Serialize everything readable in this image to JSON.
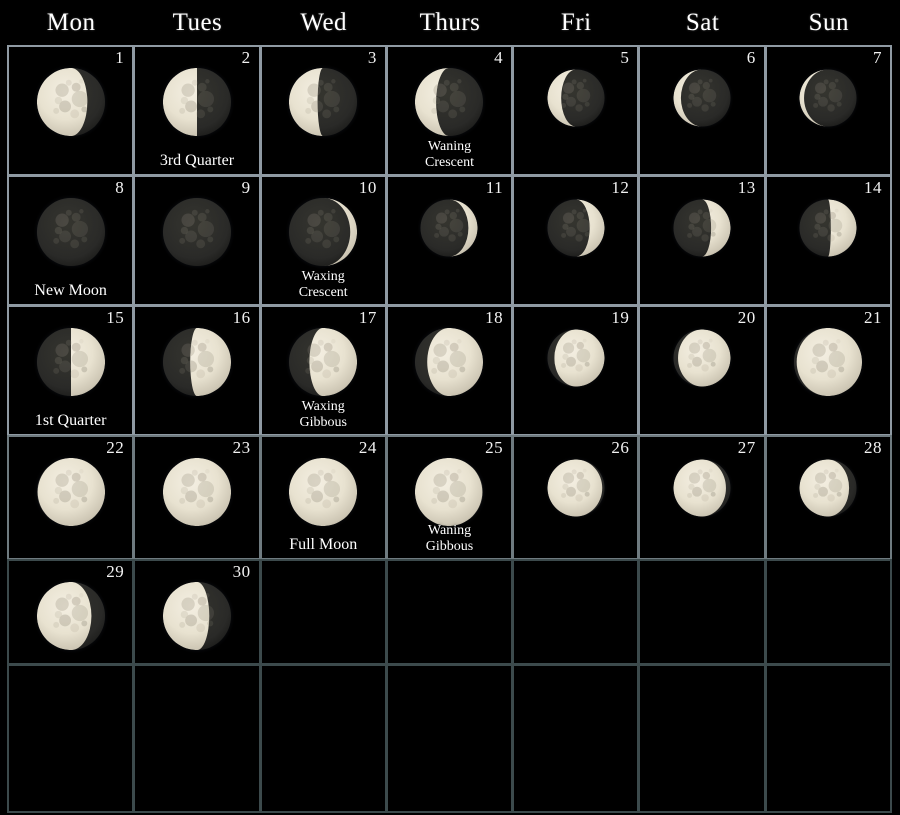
{
  "header": {
    "weekdays": [
      "Mon",
      "Tues",
      "Wed",
      "Thurs",
      "Fri",
      "Sat",
      "Sun"
    ]
  },
  "colors": {
    "background": "#000000",
    "grid_border_bright": "#8f9aa3",
    "grid_border_dim": "#3c4a4c",
    "moon_lit": "#e8e2d0",
    "moon_dark": "#2a2a28",
    "text": "#ffffff"
  },
  "calendar": {
    "rows": [
      {
        "border": "bright",
        "cells": [
          {
            "day": "1",
            "label": "",
            "phase": "waning-gibbous",
            "illum": 0.74,
            "lit_side": "left",
            "size": "normal"
          },
          {
            "day": "2",
            "label": "3rd Quarter",
            "phase": "third-quarter",
            "illum": 0.5,
            "lit_side": "left",
            "size": "normal"
          },
          {
            "day": "3",
            "label": "",
            "phase": "waning-crescent",
            "illum": 0.42,
            "lit_side": "left",
            "size": "normal"
          },
          {
            "day": "4",
            "label": "Waning\nCrescent",
            "phase": "waning-crescent",
            "illum": 0.31,
            "lit_side": "left",
            "size": "normal"
          },
          {
            "day": "5",
            "label": "",
            "phase": "waning-crescent",
            "illum": 0.24,
            "lit_side": "left",
            "size": "small"
          },
          {
            "day": "6",
            "label": "",
            "phase": "waning-crescent",
            "illum": 0.13,
            "lit_side": "left",
            "size": "small"
          },
          {
            "day": "7",
            "label": "",
            "phase": "waning-crescent",
            "illum": 0.08,
            "lit_side": "left",
            "size": "small"
          }
        ]
      },
      {
        "border": "bright",
        "cells": [
          {
            "day": "8",
            "label": "New Moon",
            "phase": "new-moon",
            "illum": 0.0,
            "lit_side": "right",
            "size": "normal"
          },
          {
            "day": "9",
            "label": "",
            "phase": "new-moon",
            "illum": 0.0,
            "lit_side": "right",
            "size": "normal"
          },
          {
            "day": "10",
            "label": "Waxing\nCrescent",
            "phase": "waxing-crescent",
            "illum": 0.1,
            "lit_side": "right",
            "size": "normal"
          },
          {
            "day": "11",
            "label": "",
            "phase": "waxing-crescent",
            "illum": 0.16,
            "lit_side": "right",
            "size": "small"
          },
          {
            "day": "12",
            "label": "",
            "phase": "waxing-crescent",
            "illum": 0.26,
            "lit_side": "right",
            "size": "small"
          },
          {
            "day": "13",
            "label": "",
            "phase": "waxing-crescent",
            "illum": 0.34,
            "lit_side": "right",
            "size": "small"
          },
          {
            "day": "14",
            "label": "",
            "phase": "waxing-crescent",
            "illum": 0.45,
            "lit_side": "right",
            "size": "small"
          }
        ]
      },
      {
        "border": "bright",
        "cells": [
          {
            "day": "15",
            "label": "1st Quarter",
            "phase": "first-quarter",
            "illum": 0.5,
            "lit_side": "right",
            "size": "normal"
          },
          {
            "day": "16",
            "label": "",
            "phase": "waxing-gibbous",
            "illum": 0.6,
            "lit_side": "right",
            "size": "normal"
          },
          {
            "day": "17",
            "label": "Waxing\nGibbous",
            "phase": "waxing-gibbous",
            "illum": 0.7,
            "lit_side": "right",
            "size": "normal"
          },
          {
            "day": "18",
            "label": "",
            "phase": "waxing-gibbous",
            "illum": 0.82,
            "lit_side": "right",
            "size": "normal"
          },
          {
            "day": "19",
            "label": "",
            "phase": "waxing-gibbous",
            "illum": 0.88,
            "lit_side": "right",
            "size": "small"
          },
          {
            "day": "20",
            "label": "",
            "phase": "waxing-gibbous",
            "illum": 0.92,
            "lit_side": "right",
            "size": "small"
          },
          {
            "day": "21",
            "label": "",
            "phase": "waxing-gibbous",
            "illum": 0.96,
            "lit_side": "right",
            "size": "normal"
          }
        ]
      },
      {
        "border": "mid",
        "cells": [
          {
            "day": "22",
            "label": "",
            "phase": "full-moon",
            "illum": 0.99,
            "lit_side": "right",
            "size": "normal"
          },
          {
            "day": "23",
            "label": "",
            "phase": "full-moon",
            "illum": 1.0,
            "lit_side": "right",
            "size": "normal"
          },
          {
            "day": "24",
            "label": "Full Moon",
            "phase": "full-moon",
            "illum": 1.0,
            "lit_side": "right",
            "size": "normal"
          },
          {
            "day": "25",
            "label": "Waning\nGibbous",
            "phase": "waning-gibbous",
            "illum": 0.99,
            "lit_side": "left",
            "size": "normal"
          },
          {
            "day": "26",
            "label": "",
            "phase": "waning-gibbous",
            "illum": 0.96,
            "lit_side": "left",
            "size": "small"
          },
          {
            "day": "27",
            "label": "",
            "phase": "waning-gibbous",
            "illum": 0.92,
            "lit_side": "left",
            "size": "small"
          },
          {
            "day": "28",
            "label": "",
            "phase": "waning-gibbous",
            "illum": 0.87,
            "lit_side": "left",
            "size": "small"
          }
        ]
      },
      {
        "border": "dim",
        "cells": [
          {
            "day": "29",
            "label": "",
            "phase": "waning-gibbous",
            "illum": 0.8,
            "lit_side": "left",
            "size": "normal"
          },
          {
            "day": "30",
            "label": "",
            "phase": "waning-gibbous",
            "illum": 0.68,
            "lit_side": "left",
            "size": "normal"
          },
          {
            "day": "",
            "label": "",
            "phase": "",
            "illum": null,
            "lit_side": "",
            "size": ""
          },
          {
            "day": "",
            "label": "",
            "phase": "",
            "illum": null,
            "lit_side": "",
            "size": ""
          },
          {
            "day": "",
            "label": "",
            "phase": "",
            "illum": null,
            "lit_side": "",
            "size": ""
          },
          {
            "day": "",
            "label": "",
            "phase": "",
            "illum": null,
            "lit_side": "",
            "size": ""
          },
          {
            "day": "",
            "label": "",
            "phase": "",
            "illum": null,
            "lit_side": "",
            "size": ""
          }
        ]
      },
      {
        "border": "dim",
        "cells": [
          {
            "day": "",
            "label": "",
            "phase": "",
            "illum": null,
            "lit_side": "",
            "size": ""
          },
          {
            "day": "",
            "label": "",
            "phase": "",
            "illum": null,
            "lit_side": "",
            "size": ""
          },
          {
            "day": "",
            "label": "",
            "phase": "",
            "illum": null,
            "lit_side": "",
            "size": ""
          },
          {
            "day": "",
            "label": "",
            "phase": "",
            "illum": null,
            "lit_side": "",
            "size": ""
          },
          {
            "day": "",
            "label": "",
            "phase": "",
            "illum": null,
            "lit_side": "",
            "size": ""
          },
          {
            "day": "",
            "label": "",
            "phase": "",
            "illum": null,
            "lit_side": "",
            "size": ""
          },
          {
            "day": "",
            "label": "",
            "phase": "",
            "illum": null,
            "lit_side": "",
            "size": ""
          }
        ]
      }
    ]
  }
}
